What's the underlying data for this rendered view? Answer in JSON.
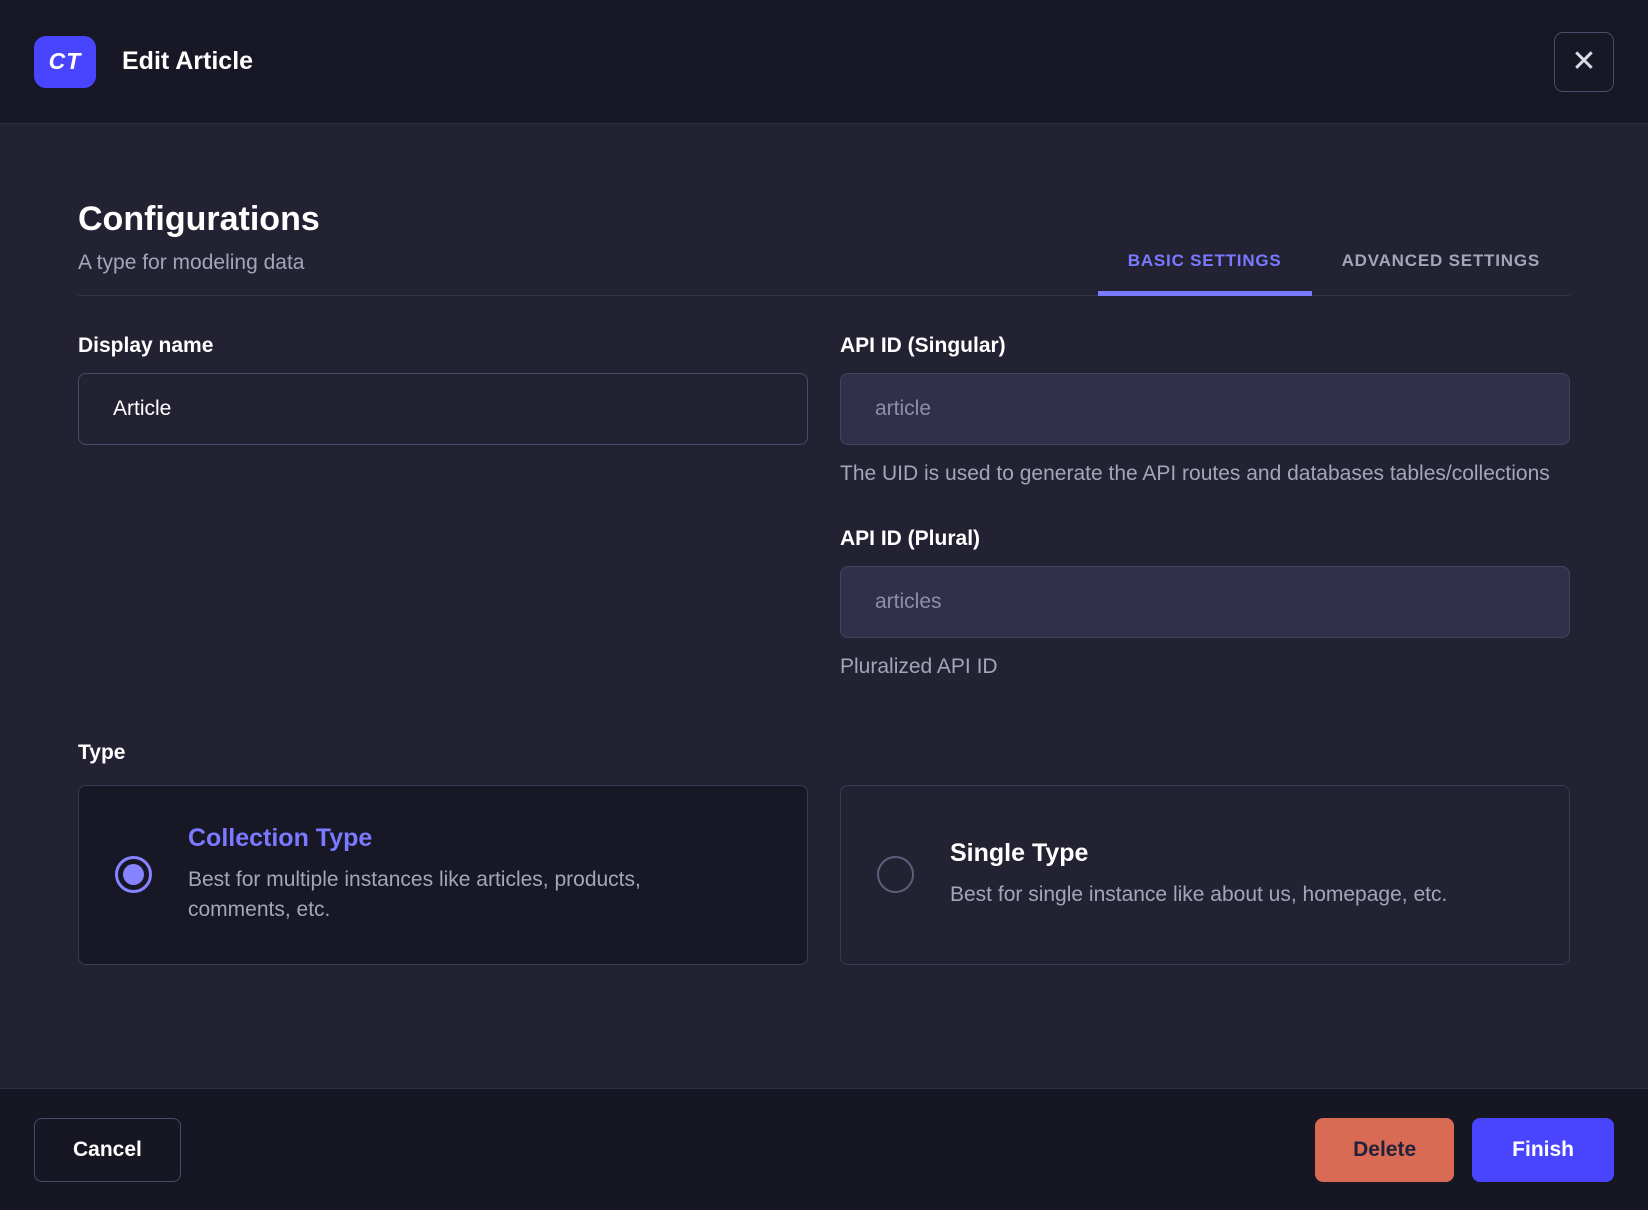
{
  "header": {
    "badge": "CT",
    "title": "Edit Article",
    "close_icon": "✕"
  },
  "config": {
    "title": "Configurations",
    "subtitle": "A type for modeling data",
    "tabs": [
      {
        "label": "BASIC SETTINGS",
        "active": true
      },
      {
        "label": "ADVANCED SETTINGS",
        "active": false
      }
    ]
  },
  "fields": {
    "display_name": {
      "label": "Display name",
      "value": "Article"
    },
    "api_id_singular": {
      "label": "API ID (Singular)",
      "value": "article",
      "helper": "The UID is used to generate the API routes and databases tables/collections",
      "disabled": true
    },
    "api_id_plural": {
      "label": "API ID (Plural)",
      "value": "articles",
      "helper": "Pluralized API ID",
      "disabled": true
    }
  },
  "type_section": {
    "label": "Type",
    "options": [
      {
        "title": "Collection Type",
        "description": "Best for multiple instances like articles, products, comments, etc.",
        "selected": true
      },
      {
        "title": "Single Type",
        "description": "Best for single instance like about us, homepage, etc.",
        "selected": false
      }
    ]
  },
  "footer": {
    "cancel_label": "Cancel",
    "delete_label": "Delete",
    "finish_label": "Finish"
  },
  "colors": {
    "accent": "#4945ff",
    "accent_light": "#7b79ff",
    "danger": "#d96b55",
    "header_bg": "#181725",
    "content_bg": "#232233",
    "muted_text": "#a5a5ba"
  }
}
